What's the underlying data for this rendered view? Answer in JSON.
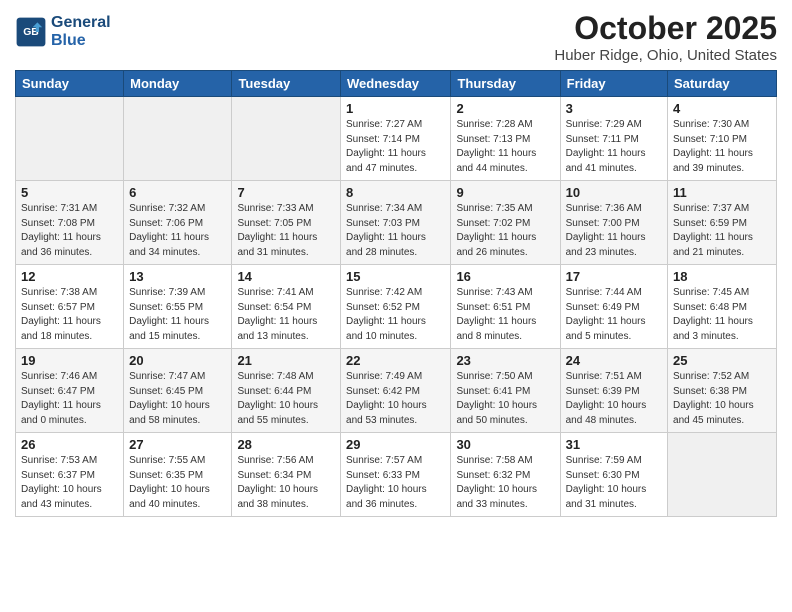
{
  "logo": {
    "line1": "General",
    "line2": "Blue"
  },
  "title": "October 2025",
  "location": "Huber Ridge, Ohio, United States",
  "days_of_week": [
    "Sunday",
    "Monday",
    "Tuesday",
    "Wednesday",
    "Thursday",
    "Friday",
    "Saturday"
  ],
  "weeks": [
    [
      {
        "day": "",
        "info": ""
      },
      {
        "day": "",
        "info": ""
      },
      {
        "day": "",
        "info": ""
      },
      {
        "day": "1",
        "info": "Sunrise: 7:27 AM\nSunset: 7:14 PM\nDaylight: 11 hours\nand 47 minutes."
      },
      {
        "day": "2",
        "info": "Sunrise: 7:28 AM\nSunset: 7:13 PM\nDaylight: 11 hours\nand 44 minutes."
      },
      {
        "day": "3",
        "info": "Sunrise: 7:29 AM\nSunset: 7:11 PM\nDaylight: 11 hours\nand 41 minutes."
      },
      {
        "day": "4",
        "info": "Sunrise: 7:30 AM\nSunset: 7:10 PM\nDaylight: 11 hours\nand 39 minutes."
      }
    ],
    [
      {
        "day": "5",
        "info": "Sunrise: 7:31 AM\nSunset: 7:08 PM\nDaylight: 11 hours\nand 36 minutes."
      },
      {
        "day": "6",
        "info": "Sunrise: 7:32 AM\nSunset: 7:06 PM\nDaylight: 11 hours\nand 34 minutes."
      },
      {
        "day": "7",
        "info": "Sunrise: 7:33 AM\nSunset: 7:05 PM\nDaylight: 11 hours\nand 31 minutes."
      },
      {
        "day": "8",
        "info": "Sunrise: 7:34 AM\nSunset: 7:03 PM\nDaylight: 11 hours\nand 28 minutes."
      },
      {
        "day": "9",
        "info": "Sunrise: 7:35 AM\nSunset: 7:02 PM\nDaylight: 11 hours\nand 26 minutes."
      },
      {
        "day": "10",
        "info": "Sunrise: 7:36 AM\nSunset: 7:00 PM\nDaylight: 11 hours\nand 23 minutes."
      },
      {
        "day": "11",
        "info": "Sunrise: 7:37 AM\nSunset: 6:59 PM\nDaylight: 11 hours\nand 21 minutes."
      }
    ],
    [
      {
        "day": "12",
        "info": "Sunrise: 7:38 AM\nSunset: 6:57 PM\nDaylight: 11 hours\nand 18 minutes."
      },
      {
        "day": "13",
        "info": "Sunrise: 7:39 AM\nSunset: 6:55 PM\nDaylight: 11 hours\nand 15 minutes."
      },
      {
        "day": "14",
        "info": "Sunrise: 7:41 AM\nSunset: 6:54 PM\nDaylight: 11 hours\nand 13 minutes."
      },
      {
        "day": "15",
        "info": "Sunrise: 7:42 AM\nSunset: 6:52 PM\nDaylight: 11 hours\nand 10 minutes."
      },
      {
        "day": "16",
        "info": "Sunrise: 7:43 AM\nSunset: 6:51 PM\nDaylight: 11 hours\nand 8 minutes."
      },
      {
        "day": "17",
        "info": "Sunrise: 7:44 AM\nSunset: 6:49 PM\nDaylight: 11 hours\nand 5 minutes."
      },
      {
        "day": "18",
        "info": "Sunrise: 7:45 AM\nSunset: 6:48 PM\nDaylight: 11 hours\nand 3 minutes."
      }
    ],
    [
      {
        "day": "19",
        "info": "Sunrise: 7:46 AM\nSunset: 6:47 PM\nDaylight: 11 hours\nand 0 minutes."
      },
      {
        "day": "20",
        "info": "Sunrise: 7:47 AM\nSunset: 6:45 PM\nDaylight: 10 hours\nand 58 minutes."
      },
      {
        "day": "21",
        "info": "Sunrise: 7:48 AM\nSunset: 6:44 PM\nDaylight: 10 hours\nand 55 minutes."
      },
      {
        "day": "22",
        "info": "Sunrise: 7:49 AM\nSunset: 6:42 PM\nDaylight: 10 hours\nand 53 minutes."
      },
      {
        "day": "23",
        "info": "Sunrise: 7:50 AM\nSunset: 6:41 PM\nDaylight: 10 hours\nand 50 minutes."
      },
      {
        "day": "24",
        "info": "Sunrise: 7:51 AM\nSunset: 6:39 PM\nDaylight: 10 hours\nand 48 minutes."
      },
      {
        "day": "25",
        "info": "Sunrise: 7:52 AM\nSunset: 6:38 PM\nDaylight: 10 hours\nand 45 minutes."
      }
    ],
    [
      {
        "day": "26",
        "info": "Sunrise: 7:53 AM\nSunset: 6:37 PM\nDaylight: 10 hours\nand 43 minutes."
      },
      {
        "day": "27",
        "info": "Sunrise: 7:55 AM\nSunset: 6:35 PM\nDaylight: 10 hours\nand 40 minutes."
      },
      {
        "day": "28",
        "info": "Sunrise: 7:56 AM\nSunset: 6:34 PM\nDaylight: 10 hours\nand 38 minutes."
      },
      {
        "day": "29",
        "info": "Sunrise: 7:57 AM\nSunset: 6:33 PM\nDaylight: 10 hours\nand 36 minutes."
      },
      {
        "day": "30",
        "info": "Sunrise: 7:58 AM\nSunset: 6:32 PM\nDaylight: 10 hours\nand 33 minutes."
      },
      {
        "day": "31",
        "info": "Sunrise: 7:59 AM\nSunset: 6:30 PM\nDaylight: 10 hours\nand 31 minutes."
      },
      {
        "day": "",
        "info": ""
      }
    ]
  ]
}
